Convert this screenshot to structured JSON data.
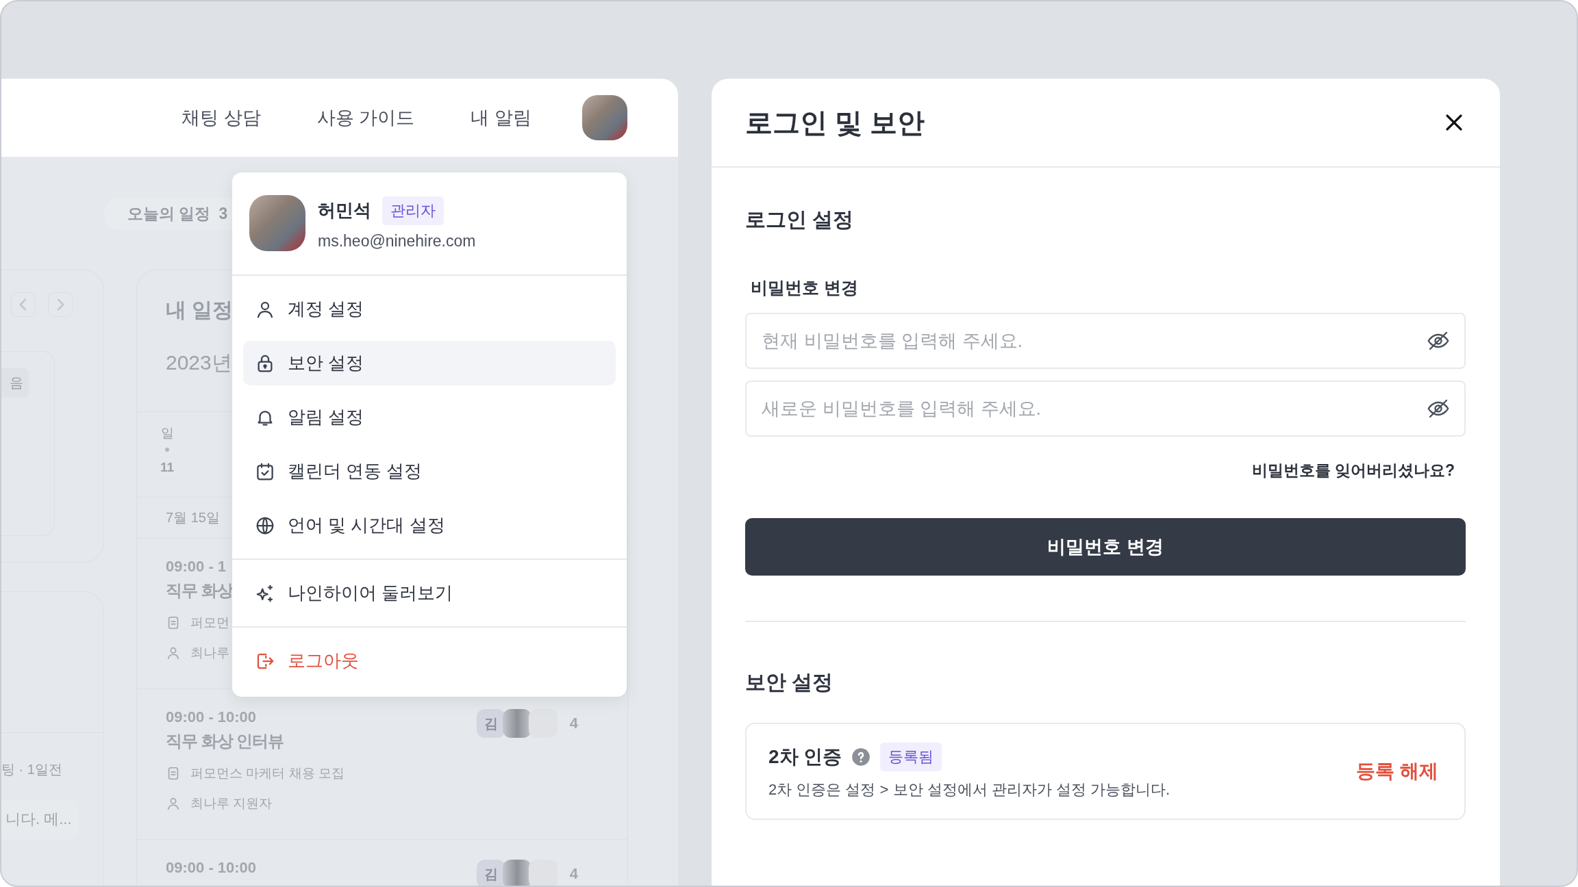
{
  "app_header": {
    "nav_links": [
      {
        "label": "채팅 상담"
      },
      {
        "label": "사용 가이드"
      },
      {
        "label": "내 알림"
      }
    ]
  },
  "today_pill": {
    "label": "오늘의 일정",
    "count": "3"
  },
  "left_cards": {
    "chip": "음",
    "meta": "팅 · 1일전",
    "preview": "니다. 메..."
  },
  "my_schedule": {
    "title": "내 일정",
    "date": "2023년",
    "weekday": "일",
    "day": "11",
    "day_header": "7월 15일",
    "events": [
      {
        "time": "09:00 - 1",
        "title": "직무 화상",
        "job": "퍼모먼",
        "person": "최나루"
      },
      {
        "time": "09:00 - 10:00",
        "title": "직무 화상 인터뷰",
        "job": "퍼모먼스 마케터 채용 모집",
        "person": "최나루 지원자",
        "attendees": {
          "initial": "김",
          "count": "4"
        }
      },
      {
        "time": "09:00 - 10:00",
        "attendees": {
          "initial": "김",
          "count": "4"
        }
      }
    ]
  },
  "profile_menu": {
    "name": "허민석",
    "role": "관리자",
    "email": "ms.heo@ninehire.com",
    "groups": [
      [
        {
          "label": "계정 설정",
          "kind": "normal",
          "selected": false
        },
        {
          "label": "보안 설정",
          "kind": "normal",
          "selected": true
        },
        {
          "label": "알림 설정",
          "kind": "normal",
          "selected": false
        },
        {
          "label": "캘린더 연동 설정",
          "kind": "normal",
          "selected": false
        },
        {
          "label": "언어 및 시간대 설정",
          "kind": "normal",
          "selected": false
        }
      ],
      [
        {
          "label": "나인하이어 둘러보기",
          "kind": "normal",
          "selected": false
        }
      ],
      [
        {
          "label": "로그아웃",
          "kind": "danger",
          "selected": false
        }
      ]
    ]
  },
  "security_panel": {
    "title": "로그인 및 보안",
    "login_section": {
      "title": "로그인 설정",
      "password_label": "비밀번호 변경",
      "fields": [
        {
          "placeholder": "현재 비밀번호를 입력해 주세요."
        },
        {
          "placeholder": "새로운 비밀번호를 입력해 주세요."
        }
      ],
      "forgot_link": "비밀번호를 잊어버리셨나요?",
      "submit": "비밀번호 변경"
    },
    "security_section": {
      "title": "보안 설정",
      "two_factor": {
        "title": "2차 인증",
        "status": "등록됨",
        "description": "2차 인증은 설정 > 보안 설정에서 관리자가 설정 가능합니다.",
        "action": "등록 해제"
      }
    }
  }
}
